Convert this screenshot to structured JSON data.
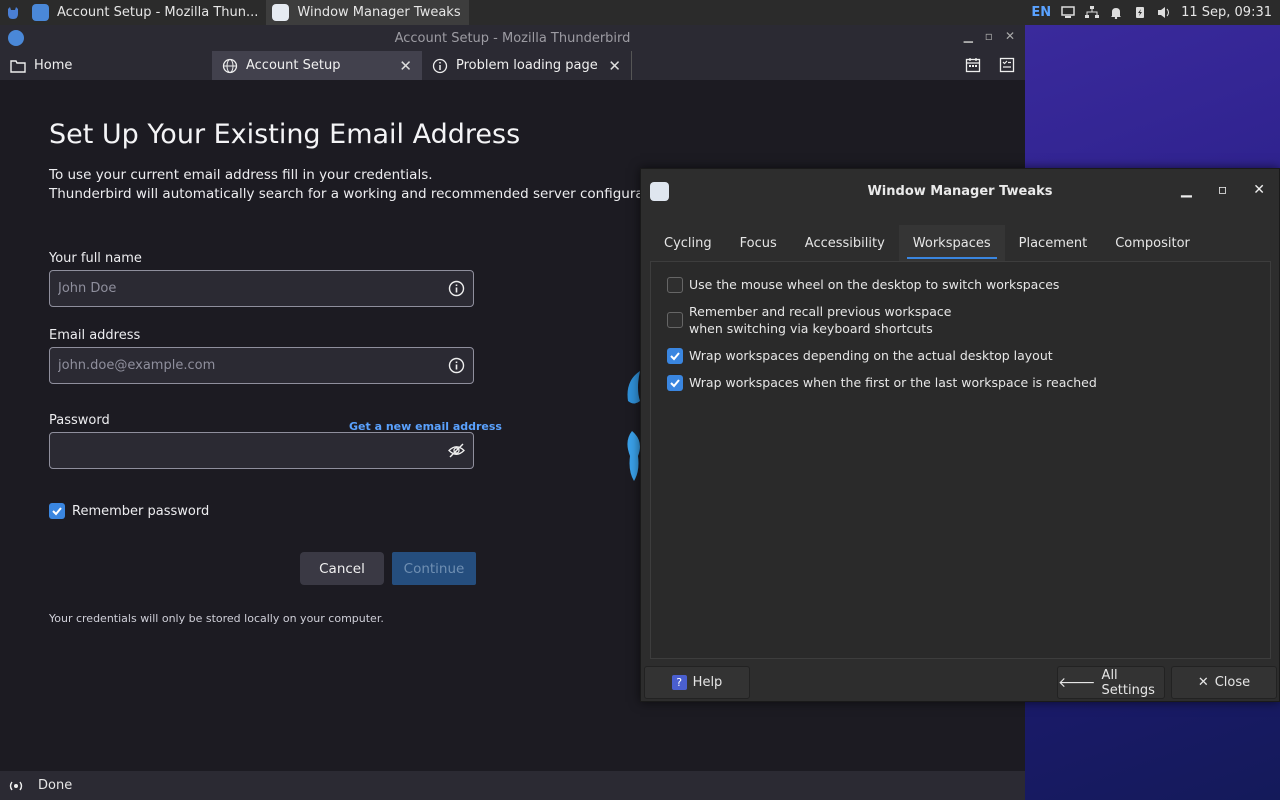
{
  "panel": {
    "tasks": [
      {
        "label": "Account Setup - Mozilla Thun..."
      },
      {
        "label": "Window Manager Tweaks"
      }
    ],
    "lang": "EN",
    "clock": "11 Sep, 09:31"
  },
  "thunderbird": {
    "title": "Account Setup - Mozilla Thunderbird",
    "tabs": [
      {
        "label": "Home"
      },
      {
        "label": "Account Setup"
      },
      {
        "label": "Problem loading page"
      }
    ],
    "heading": "Set Up Your Existing Email Address",
    "intro_line1": "To use your current email address fill in your credentials.",
    "intro_line2": "Thunderbird will automatically search for a working and recommended server configuration.",
    "fullname_label": "Your full name",
    "fullname_placeholder": "John Doe",
    "email_label": "Email address",
    "email_placeholder": "john.doe@example.com",
    "get_new_email": "Get a new email address",
    "password_label": "Password",
    "remember_label": "Remember password",
    "remember_checked": true,
    "cancel_label": "Cancel",
    "continue_label": "Continue",
    "cred_note": "Your credentials will only be stored locally on your computer.",
    "status": "Done"
  },
  "wmtweaks": {
    "title": "Window Manager Tweaks",
    "tabs": [
      "Cycling",
      "Focus",
      "Accessibility",
      "Workspaces",
      "Placement",
      "Compositor"
    ],
    "selected_tab": "Workspaces",
    "options": [
      {
        "line1": "Use the mouse wheel on the desktop to switch workspaces",
        "line2": "",
        "checked": false
      },
      {
        "line1": "Remember and recall previous workspace",
        "line2": "when switching via keyboard shortcuts",
        "checked": false
      },
      {
        "line1": "Wrap workspaces depending on the actual desktop layout",
        "line2": "",
        "checked": true
      },
      {
        "line1": "Wrap workspaces when the first or the last workspace is reached",
        "line2": "",
        "checked": true
      }
    ],
    "help_label": "Help",
    "all_settings_label": "All Settings",
    "close_label": "Close"
  },
  "colors": {
    "accent": "#3a86e0",
    "link": "#5aa2ff",
    "desktop": "#2a1f88"
  }
}
